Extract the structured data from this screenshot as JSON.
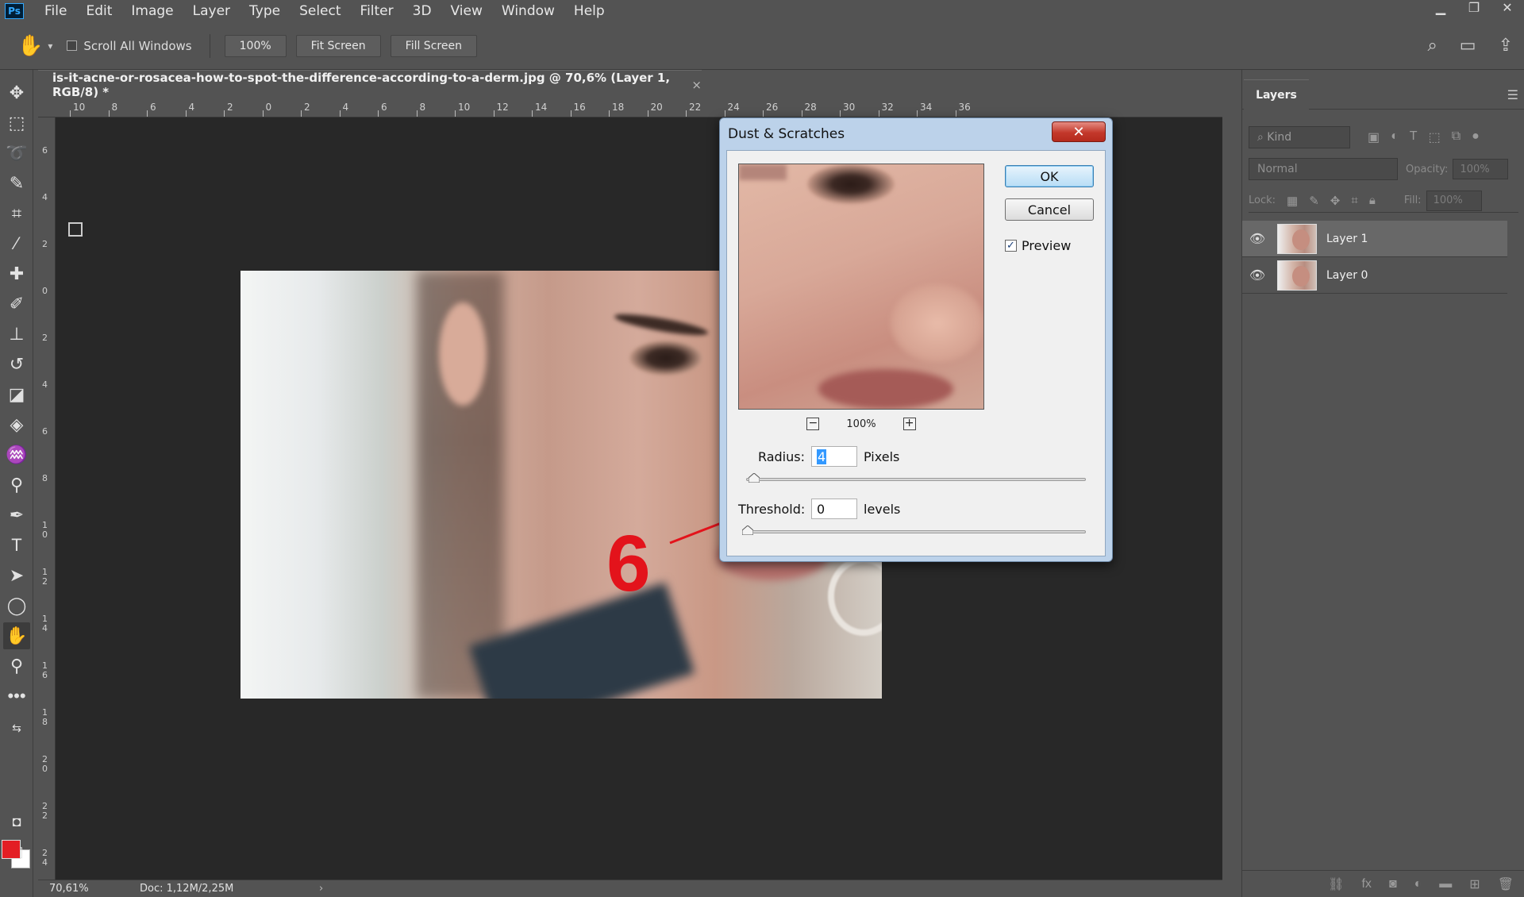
{
  "app": {
    "logo": "Ps"
  },
  "menubar": {
    "items": [
      "File",
      "Edit",
      "Image",
      "Layer",
      "Type",
      "Select",
      "Filter",
      "3D",
      "View",
      "Window",
      "Help"
    ]
  },
  "options": {
    "scroll_all_windows": "Scroll All Windows",
    "zoom": "100%",
    "fit_screen": "Fit Screen",
    "fill_screen": "Fill Screen"
  },
  "document": {
    "tab_title": "is-it-acne-or-rosacea-how-to-spot-the-difference-according-to-a-derm.jpg @ 70,6% (Layer 1, RGB/8) *",
    "close_glyph": "×"
  },
  "rulers": {
    "top": [
      "10",
      "8",
      "6",
      "4",
      "2",
      "0",
      "2",
      "4",
      "6",
      "8",
      "10",
      "12",
      "14",
      "16",
      "18",
      "20",
      "22",
      "24",
      "26",
      "28",
      "30",
      "32",
      "34",
      "36"
    ],
    "left": [
      "6",
      "4",
      "2",
      "0",
      "2",
      "4",
      "6",
      "8",
      "10",
      "12",
      "14",
      "16",
      "18",
      "20",
      "22",
      "24"
    ]
  },
  "dialog": {
    "title": "Dust & Scratches",
    "close_glyph": "✕",
    "ok": "OK",
    "cancel": "Cancel",
    "preview_label": "Preview",
    "preview_checked": true,
    "zoom_level": "100%",
    "zoom_out": "−",
    "zoom_in": "+",
    "radius_label": "Radius:",
    "radius_value": "4",
    "radius_unit": "Pixels",
    "threshold_label": "Threshold:",
    "threshold_value": "0",
    "threshold_unit": "levels"
  },
  "annotation": {
    "number": "6",
    "color": "#e3131b"
  },
  "layers_panel": {
    "tab": "Layers",
    "kind_placeholder": "Kind",
    "blend_mode": "Normal",
    "opacity_label": "Opacity:",
    "opacity_value": "100%",
    "lock_label": "Lock:",
    "fill_label": "Fill:",
    "fill_value": "100%",
    "layers": [
      {
        "name": "Layer 1",
        "selected": true
      },
      {
        "name": "Layer 0",
        "selected": false
      }
    ]
  },
  "statusbar": {
    "zoom": "70,61%",
    "doc": "Doc: 1,12M/2,25M",
    "arrow": "›"
  },
  "colors": {
    "foreground": "#e31e24",
    "background": "#ffffff",
    "ui_bg": "#535353",
    "canvas_bg": "#282828"
  }
}
